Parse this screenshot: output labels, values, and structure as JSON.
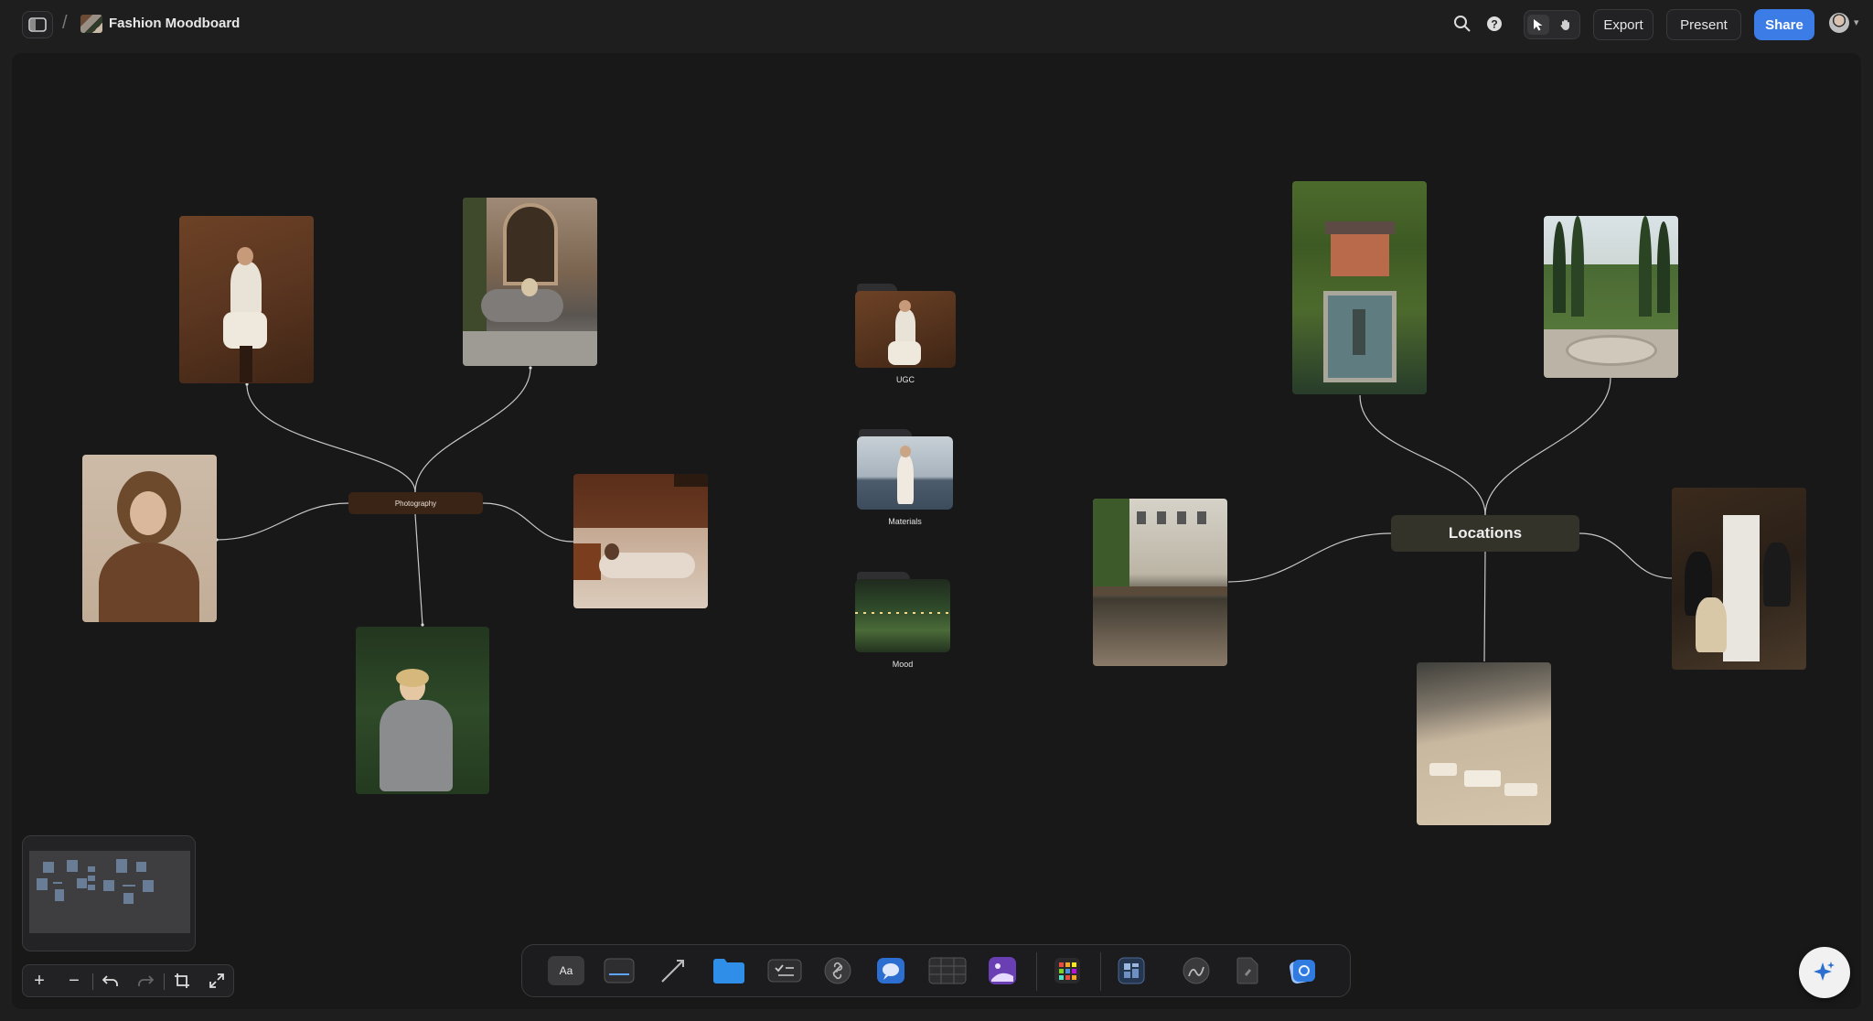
{
  "app": {
    "board_title": "Fashion Moodboard",
    "breadcrumb_separator": "/"
  },
  "toolbar": {
    "export_label": "Export",
    "present_label": "Present",
    "share_label": "Share",
    "active_tool": "select",
    "accent_color": "#3b7ce6"
  },
  "board": {
    "photography_hub": "Photography",
    "locations_hub": "Locations",
    "folders": [
      {
        "label": "UGC"
      },
      {
        "label": "Materials"
      },
      {
        "label": "Mood"
      }
    ],
    "photography_images": [
      "portrait-seated-stool",
      "model-on-stone-steps",
      "wind-blown-hair-portrait",
      "reclining-model-sofa",
      "grey-suit-in-greenery"
    ],
    "location_images": [
      "chateau-garden-pool",
      "cypress-garden-fountain",
      "paris-cafe-terrace",
      "elegant-dinner-party",
      "beach-lounge-aerial"
    ]
  },
  "zoom_controls": {
    "zoom_in": "+",
    "zoom_out": "−"
  },
  "dock": {
    "text_tool_label": "Aa",
    "items": [
      "text",
      "note",
      "arrow",
      "folder",
      "checklist",
      "link",
      "comment",
      "table",
      "image",
      "apps",
      "board",
      "sketch",
      "document",
      "upload"
    ]
  }
}
